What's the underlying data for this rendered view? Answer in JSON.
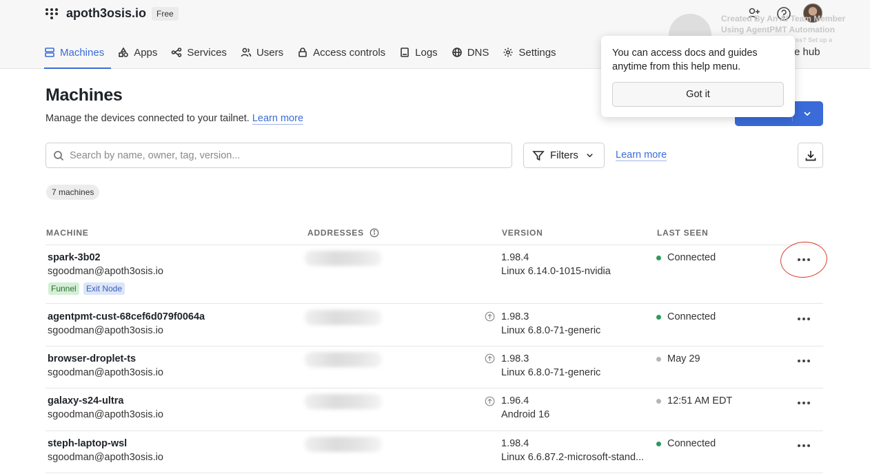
{
  "header": {
    "brand": "apoth3osis.io",
    "plan": "Free",
    "nav": [
      {
        "label": "Machines",
        "icon": "machines-icon",
        "active": true
      },
      {
        "label": "Apps",
        "icon": "apps-icon"
      },
      {
        "label": "Services",
        "icon": "services-icon"
      },
      {
        "label": "Users",
        "icon": "users-icon"
      },
      {
        "label": "Access controls",
        "icon": "lock-icon"
      },
      {
        "label": "Logs",
        "icon": "logs-icon"
      },
      {
        "label": "DNS",
        "icon": "globe-icon"
      },
      {
        "label": "Settings",
        "icon": "gear-icon"
      }
    ],
    "nav_right_partial": "e hub"
  },
  "watermark": {
    "line1": "Created By An AI Team Member",
    "line2": "Using AgentPMT Automation",
    "line3": "Want this for your business? Set up a consultation today!"
  },
  "tooltip": {
    "text": "You can access docs and guides anytime from this help menu.",
    "button": "Got it"
  },
  "page": {
    "title": "Machines",
    "subtitle": "Manage the devices connected to your tailnet.",
    "learn_more": "Learn more"
  },
  "toolbar": {
    "search_placeholder": "Search by name, owner, tag, version...",
    "filters_label": "Filters",
    "learn_more": "Learn more"
  },
  "machine_count": "7 machines",
  "table": {
    "headers": [
      "MACHINE",
      "ADDRESSES",
      "VERSION",
      "LAST SEEN"
    ],
    "rows": [
      {
        "name": "spark-3b02",
        "owner": "sgoodman@apoth3osis.io",
        "version": "1.98.4",
        "os": "Linux 6.14.0-1015-nvidia",
        "status": "Connected",
        "online": true,
        "update": false,
        "tags": [
          "Funnel",
          "Exit Node"
        ]
      },
      {
        "name": "agentpmt-cust-68cef6d079f0064a",
        "owner": "sgoodman@apoth3osis.io",
        "version": "1.98.3",
        "os": "Linux 6.8.0-71-generic",
        "status": "Connected",
        "online": true,
        "update": true
      },
      {
        "name": "browser-droplet-ts",
        "owner": "sgoodman@apoth3osis.io",
        "version": "1.98.3",
        "os": "Linux 6.8.0-71-generic",
        "status": "May 29",
        "online": false,
        "update": true
      },
      {
        "name": "galaxy-s24-ultra",
        "owner": "sgoodman@apoth3osis.io",
        "version": "1.96.4",
        "os": "Android 16",
        "status": "12:51 AM EDT",
        "online": false,
        "update": true
      },
      {
        "name": "steph-laptop-wsl",
        "owner": "sgoodman@apoth3osis.io",
        "version": "1.98.4",
        "os": "Linux 6.6.87.2-microsoft-stand...",
        "status": "Connected",
        "online": true,
        "update": false
      }
    ]
  },
  "colors": {
    "accent": "#3a6bd8",
    "online": "#2e9a5a",
    "offline": "#b5b5b5",
    "annotation": "#d8392c"
  }
}
